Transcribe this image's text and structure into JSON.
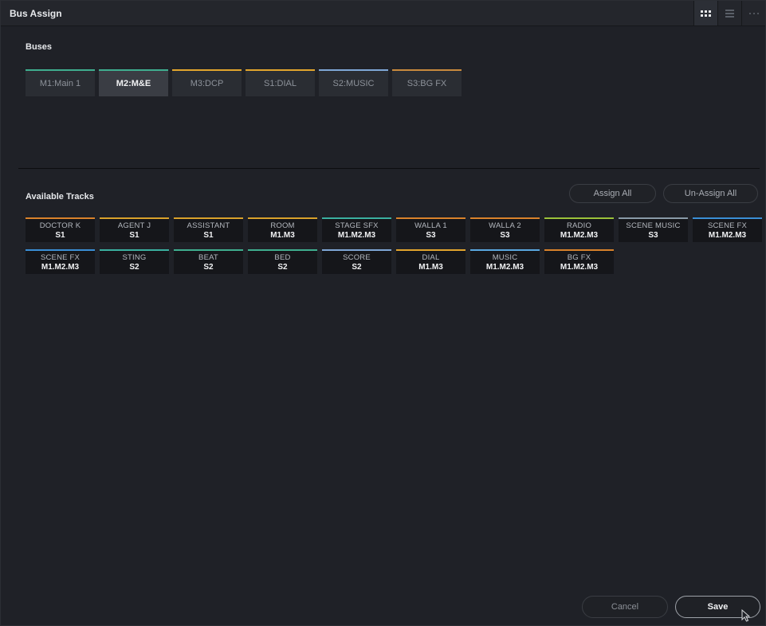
{
  "window": {
    "title": "Bus Assign",
    "view_icons": [
      "grid-view-icon",
      "list-view-icon",
      "more-options-icon"
    ]
  },
  "buses_section": {
    "label": "Buses",
    "buses": [
      {
        "label": "M1:Main 1",
        "color": "#3fae8f",
        "selected": false
      },
      {
        "label": "M2:M&E",
        "color": "#3fae8f",
        "selected": true
      },
      {
        "label": "M3:DCP",
        "color": "#e2a52d",
        "selected": false
      },
      {
        "label": "S1:DIAL",
        "color": "#e2a52d",
        "selected": false
      },
      {
        "label": "S2:MUSIC",
        "color": "#7fa7d6",
        "selected": false
      },
      {
        "label": "S3:BG FX",
        "color": "#c98a3d",
        "selected": false
      }
    ]
  },
  "tracks_section": {
    "label": "Available Tracks",
    "assign_all_label": "Assign All",
    "unassign_all_label": "Un-Assign All",
    "tracks": [
      {
        "name": "DOCTOR K",
        "bus": "S1",
        "color": "#d9822b"
      },
      {
        "name": "AGENT J",
        "bus": "S1",
        "color": "#d9a22b"
      },
      {
        "name": "ASSISTANT",
        "bus": "S1",
        "color": "#d9a22b"
      },
      {
        "name": "ROOM",
        "bus": "M1.M3",
        "color": "#d9a22b"
      },
      {
        "name": "STAGE SFX",
        "bus": "M1.M2.M3",
        "color": "#3ab0a0"
      },
      {
        "name": "WALLA 1",
        "bus": "S3",
        "color": "#d9822b"
      },
      {
        "name": "WALLA 2",
        "bus": "S3",
        "color": "#d9822b"
      },
      {
        "name": "RADIO",
        "bus": "M1.M2.M3",
        "color": "#9bc23a"
      },
      {
        "name": "SCENE MUSIC",
        "bus": "S3",
        "color": "#8a9aa8"
      },
      {
        "name": "SCENE FX",
        "bus": "M1.M2.M3",
        "color": "#3a8fd6"
      },
      {
        "name": "SCENE FX",
        "bus": "M1.M2.M3",
        "color": "#3a8fd6"
      },
      {
        "name": "STING",
        "bus": "S2",
        "color": "#3ab0a0"
      },
      {
        "name": "BEAT",
        "bus": "S2",
        "color": "#3fae8f"
      },
      {
        "name": "BED",
        "bus": "S2",
        "color": "#3fae8f"
      },
      {
        "name": "SCORE",
        "bus": "S2",
        "color": "#7fa7d6"
      },
      {
        "name": "DIAL",
        "bus": "M1.M3",
        "color": "#e2a52d"
      },
      {
        "name": "MUSIC",
        "bus": "M1.M2.M3",
        "color": "#5aa8e0"
      },
      {
        "name": "BG FX",
        "bus": "M1.M2.M3",
        "color": "#d9822b"
      }
    ]
  },
  "footer": {
    "cancel_label": "Cancel",
    "save_label": "Save"
  }
}
